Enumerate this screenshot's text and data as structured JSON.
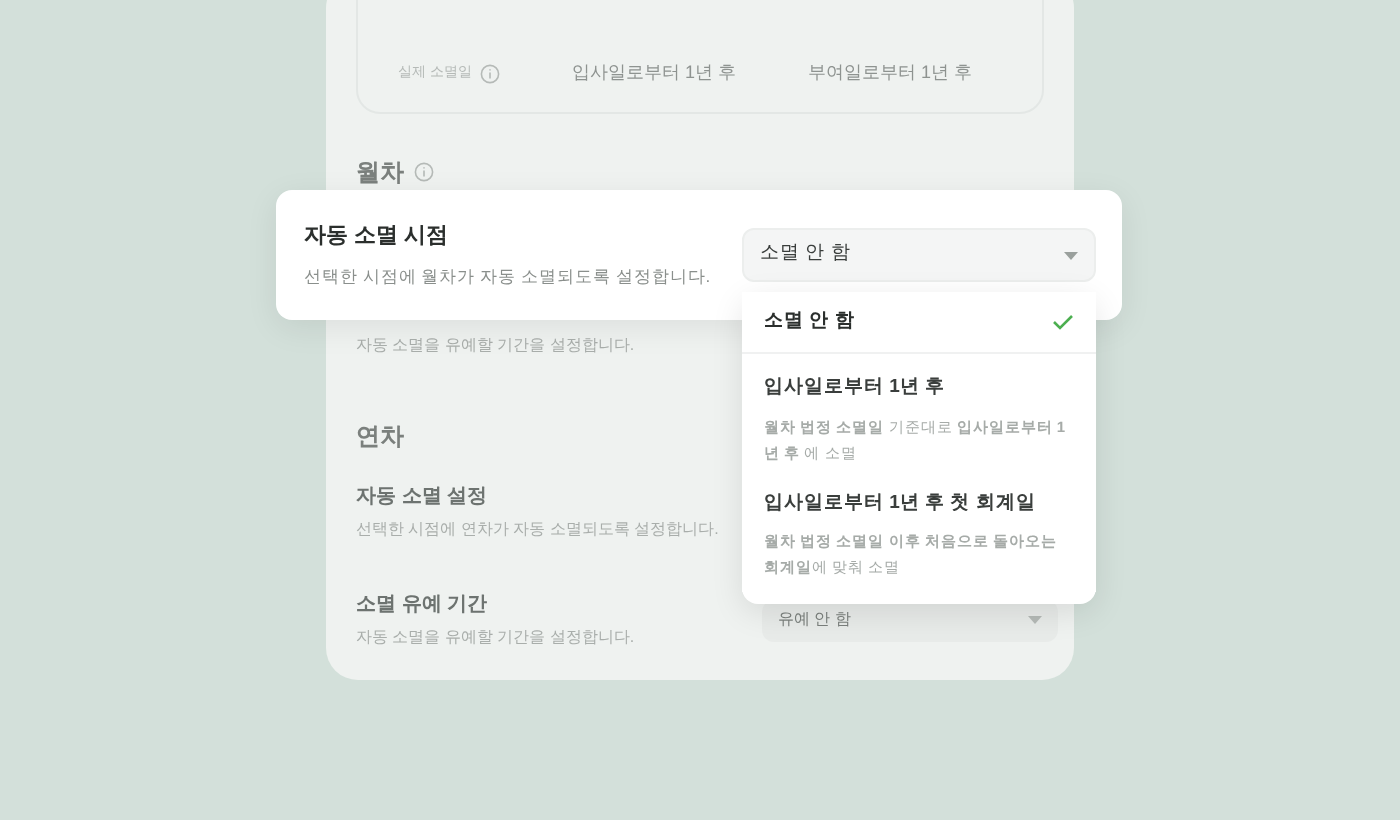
{
  "summary_table": {
    "rows": [
      {
        "label": "실제 소멸일",
        "values": [
          "입사일로부터 1년 후",
          "부여일로부터 1년 후"
        ]
      }
    ]
  },
  "monthly": {
    "title": "월차",
    "settings": [
      {
        "description": "자동 소멸을 유예할 기간을 설정합니다."
      }
    ]
  },
  "annual": {
    "title": "연차",
    "settings": [
      {
        "title": "자동 소멸 설정",
        "description": "선택한 시점에 연차가 자동 소멸되도록 설정합니다."
      },
      {
        "title": "소멸 유예 기간",
        "description": "자동 소멸을 유예할 기간을 설정합니다.",
        "select": "유예 안 함"
      }
    ]
  },
  "popup": {
    "title": "자동 소멸 시점",
    "description": "선택한 시점에 월차가 자동 소멸되도록 설정합니다.",
    "select": "소멸 안 함"
  },
  "dropdown": [
    {
      "label": "소멸 안 함",
      "selected": true
    },
    {
      "label": "입사일로부터 1년 후",
      "description": "**월차 법정 소멸일** 기준대로 **입사일로부터 1년 후** 에 소멸",
      "selected": false
    },
    {
      "label": "입사일로부터 1년 후 첫 회계일",
      "description": "**월차 법정 소멸일 이후 처음으로 돌아오는 회계일**에 맞춰 소멸",
      "selected": false
    }
  ]
}
